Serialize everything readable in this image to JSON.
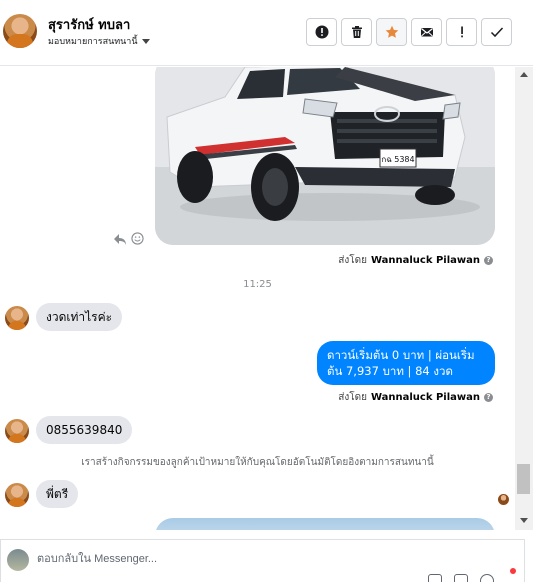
{
  "header": {
    "contact_name": "สุรารักษ์ ทบลา",
    "assign_label": "มอบหมายการสนทนานี้",
    "actions": [
      {
        "name": "spam-button",
        "icon": "exclamation-circle-icon"
      },
      {
        "name": "delete-button",
        "icon": "trash-icon"
      },
      {
        "name": "star-button",
        "icon": "star-icon",
        "color": "#e8883a"
      },
      {
        "name": "mark-unread-button",
        "icon": "envelope-icon"
      },
      {
        "name": "follow-up-button",
        "icon": "exclamation-icon"
      },
      {
        "name": "done-button",
        "icon": "checkmark-icon"
      }
    ]
  },
  "conversation": {
    "photo_message": {
      "plate": "กฉ 5384",
      "reply_icon": "reply-icon",
      "react_icon": "smiley-icon"
    },
    "sent_by_prefix": "ส่งโดย",
    "sent_by_name": "Wannaluck Pilawan",
    "time": "11:25",
    "msg_incoming_1": "งวดเท่าไรค่ะ",
    "msg_outgoing_1": "ดาวน์เริ่มต้น 0 บาท | ผ่อนเริ่มต้น 7,937 บาท | 84 งวด",
    "msg_incoming_2": "0855639840",
    "system_note": "เราสร้างกิจกรรมของลูกค้าเป้าหมายให้กับคุณโดยอัตโนมัติโดยอิงตามการสนทนานี้",
    "msg_incoming_3": "พี่ตรี",
    "outgoing_color": "#0084ff",
    "incoming_color": "#e4e6eb"
  },
  "composer": {
    "placeholder": "ตอบกลับใน Messenger..."
  }
}
